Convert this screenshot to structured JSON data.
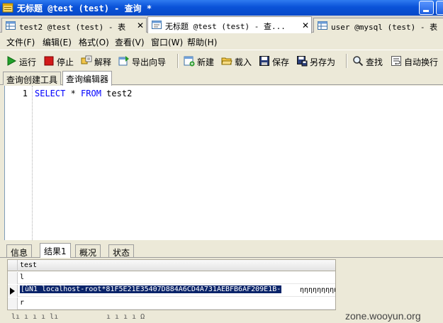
{
  "window": {
    "title": "无标题 @test (test) - 查询 *"
  },
  "doc_tabs": [
    {
      "label": "test2 @test (test) - 表",
      "icon": "table-icon",
      "close": "✕"
    },
    {
      "label": "无标题 @test (test) - 查...",
      "icon": "query-icon",
      "close": "✕"
    },
    {
      "label": "user @mysql (test) - 表",
      "icon": "table-icon"
    }
  ],
  "menu": [
    {
      "label": "文件(F)"
    },
    {
      "label": "编辑(E)"
    },
    {
      "label": "格式(O)"
    },
    {
      "label": "查看(V)"
    },
    {
      "label": "窗口(W)"
    },
    {
      "label": "帮助(H)"
    }
  ],
  "toolbar": {
    "run": "运行",
    "stop": "停止",
    "explain": "解释",
    "export_wizard": "导出向导",
    "new": "新建",
    "load": "载入",
    "save": "保存",
    "save_as": "另存为",
    "find": "查找",
    "word_wrap": "自动换行"
  },
  "editor_tabs": [
    {
      "label": "查询创建工具"
    },
    {
      "label": "查询编辑器"
    }
  ],
  "editor": {
    "line_number": "1",
    "kw_select": "SELECT",
    "star": " * ",
    "kw_from": "FROM",
    "table": " test2"
  },
  "result_tabs": [
    {
      "label": "信息"
    },
    {
      "label": "结果1"
    },
    {
      "label": "概况"
    },
    {
      "label": "状态"
    }
  ],
  "grid": {
    "column": "test",
    "rows": [
      {
        "value": "l"
      },
      {
        "value": "[ùÑ1    localhost-root*81F5E21E35407D884A6CD4A731AEBFB6AF209E1B-",
        "tail": "ηηηηηηηηηη"
      },
      {
        "value": "r"
      }
    ]
  },
  "status": {
    "frag1": "lı ı ı ı lı",
    "frag2": "ı ı ı ı Ω"
  },
  "watermark": "zone.wooyun.org",
  "colors": {
    "title_bar": "#0a52d8",
    "keyword": "#0000ff",
    "selection": "#0a246a"
  }
}
